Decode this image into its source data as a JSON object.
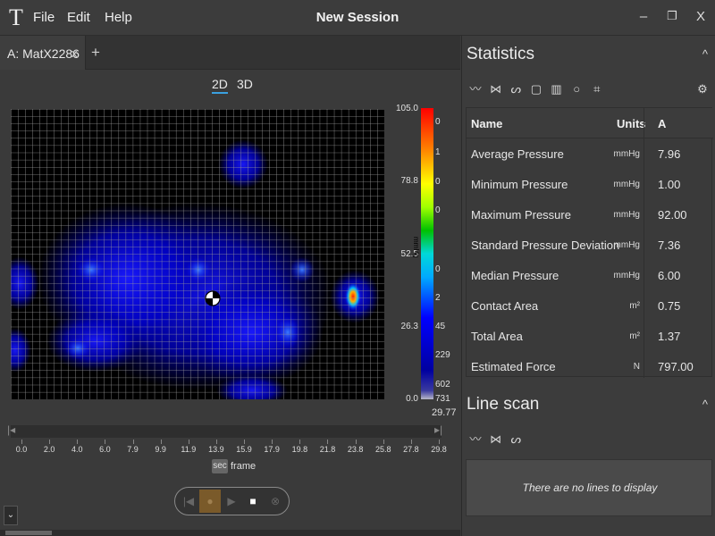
{
  "app": {
    "logo_glyph": "T",
    "title": "New Session",
    "menu": [
      "File",
      "Edit",
      "Help"
    ],
    "window_buttons": {
      "minimize": "–",
      "restore": "❐",
      "close": "X"
    }
  },
  "tabs": {
    "items": [
      {
        "label": "A: MatX2286",
        "close": "x"
      }
    ],
    "add": "+"
  },
  "view": {
    "modes": [
      "2D",
      "3D"
    ],
    "active": "2D"
  },
  "heatmap": {
    "scale_ticks": [
      "105.0",
      "78.8",
      "52.5",
      "26.3",
      "0.0"
    ],
    "scale_values": [
      "0",
      "1",
      "0",
      "0",
      "0",
      "2",
      "45",
      "229",
      "602",
      "731"
    ],
    "scale_units": "mmHg",
    "scale_total": "29.77",
    "colors": {
      "background": "#000000",
      "grid": "#9a9a9a",
      "low": "#0000ff",
      "high": "#ff0000"
    }
  },
  "timeline": {
    "ticks": [
      "0.0",
      "2.0",
      "4.0",
      "6.0",
      "7.9",
      "9.9",
      "11.9",
      "13.9",
      "15.9",
      "17.9",
      "19.8",
      "21.8",
      "23.8",
      "25.8",
      "27.8",
      "29.8"
    ],
    "unit_active": "sec",
    "unit_other": "frame",
    "start_icon": "|◂",
    "end_icon": "▸|"
  },
  "playback": {
    "prev": "|◀",
    "play": "●",
    "next": "▶",
    "stop": "■",
    "record": "⊗"
  },
  "collapse_icon": "⌄",
  "statistics": {
    "title": "Statistics",
    "chevron": "^",
    "toolbar_icons": [
      "line-icon",
      "cross-line-icon",
      "freehand-icon",
      "rectangle-icon",
      "rectangle-grid-icon",
      "circle-icon",
      "sensor-icon",
      "settings-icon"
    ],
    "columns": [
      "Name",
      "Units",
      "A"
    ],
    "rows": [
      {
        "name": "Average Pressure",
        "unit": "mmHg",
        "value": "7.96"
      },
      {
        "name": "Minimum Pressure",
        "unit": "mmHg",
        "value": "1.00"
      },
      {
        "name": "Maximum Pressure",
        "unit": "mmHg",
        "value": "92.00"
      },
      {
        "name": "Standard Pressure Deviation",
        "unit": "mmHg",
        "value": "7.36"
      },
      {
        "name": "Median Pressure",
        "unit": "mmHg",
        "value": "6.00"
      },
      {
        "name": "Contact Area",
        "unit": "m²",
        "value": "0.75"
      },
      {
        "name": "Total Area",
        "unit": "m²",
        "value": "1.37"
      },
      {
        "name": "Estimated Force",
        "unit": "N",
        "value": "797.00"
      }
    ]
  },
  "line_scan": {
    "title": "Line scan",
    "chevron": "^",
    "toolbar_icons": [
      "line-icon",
      "cross-line-icon",
      "freehand-icon"
    ],
    "empty_text": "There are no lines to display"
  },
  "accent_color": "#3aa0e0"
}
